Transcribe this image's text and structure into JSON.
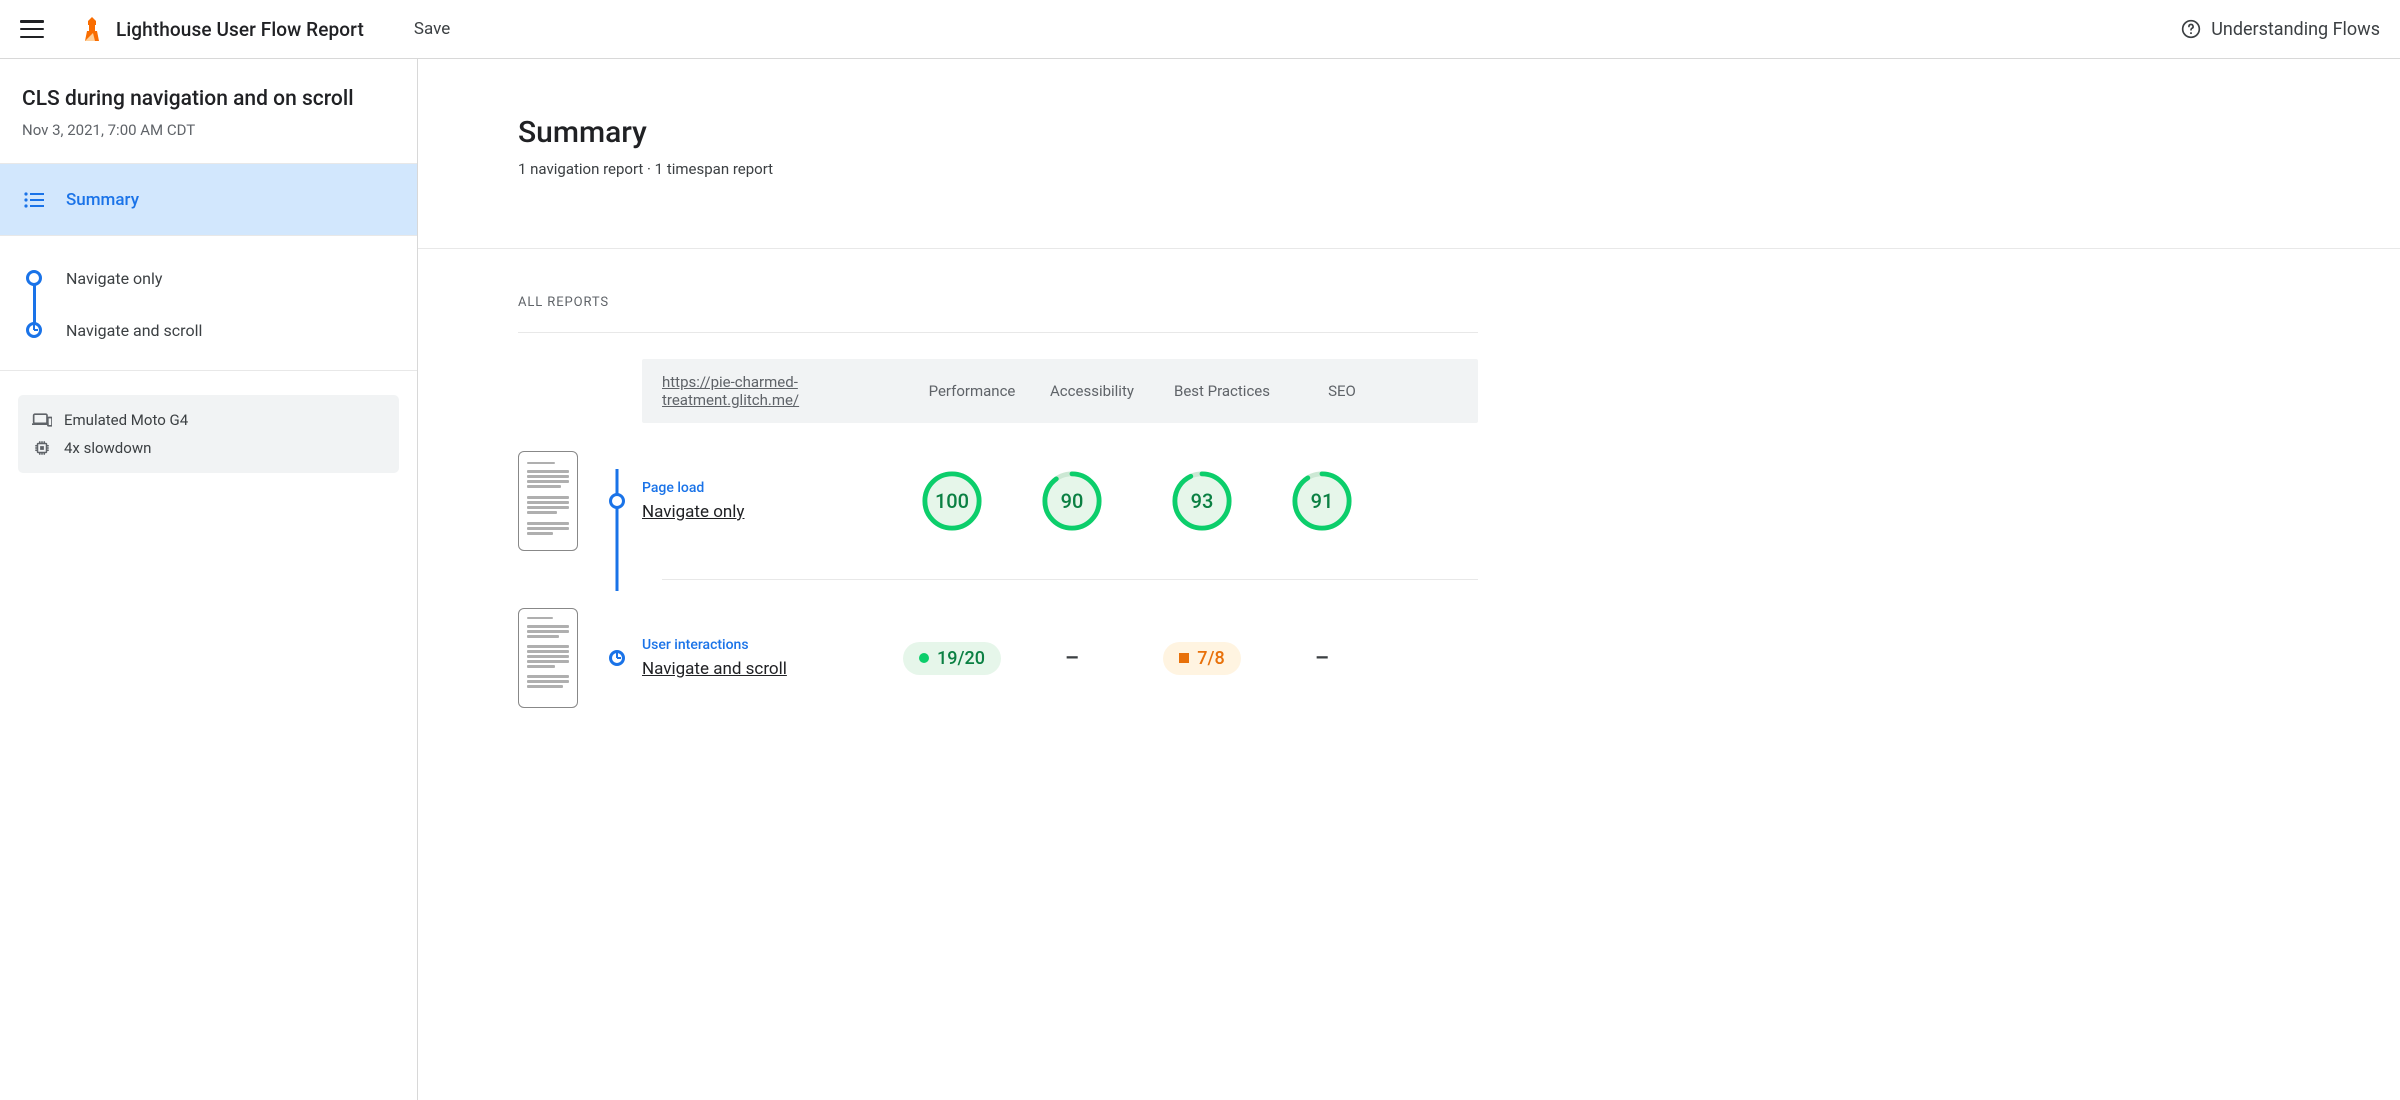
{
  "topbar": {
    "title": "Lighthouse User Flow Report",
    "save": "Save",
    "help": "Understanding Flows"
  },
  "sidebar": {
    "flow_name": "CLS during navigation and on scroll",
    "date": "Nov 3, 2021, 7:00 AM CDT",
    "summary_label": "Summary",
    "steps": [
      {
        "label": "Navigate only",
        "marker": "circle"
      },
      {
        "label": "Navigate and scroll",
        "marker": "clock"
      }
    ],
    "env": {
      "device": "Emulated Moto G4",
      "throttle": "4x slowdown"
    }
  },
  "main": {
    "title": "Summary",
    "subtitle": "1 navigation report · 1 timespan report",
    "all_reports_label": "ALL REPORTS",
    "table": {
      "url": "https://pie-charmed-treatment.glitch.me/",
      "columns": [
        "Performance",
        "Accessibility",
        "Best Practices",
        "SEO"
      ]
    },
    "rows": [
      {
        "kind": "Page load",
        "name": "Navigate only",
        "marker": "circle",
        "cells": [
          {
            "type": "gauge",
            "value": 100
          },
          {
            "type": "gauge",
            "value": 90
          },
          {
            "type": "gauge",
            "value": 93
          },
          {
            "type": "gauge",
            "value": 91
          }
        ]
      },
      {
        "kind": "User interactions",
        "name": "Navigate and scroll",
        "marker": "clock",
        "cells": [
          {
            "type": "pill",
            "variant": "green",
            "text": "19/20"
          },
          {
            "type": "dash"
          },
          {
            "type": "pill",
            "variant": "orange",
            "text": "7/8"
          },
          {
            "type": "dash"
          }
        ]
      }
    ]
  }
}
